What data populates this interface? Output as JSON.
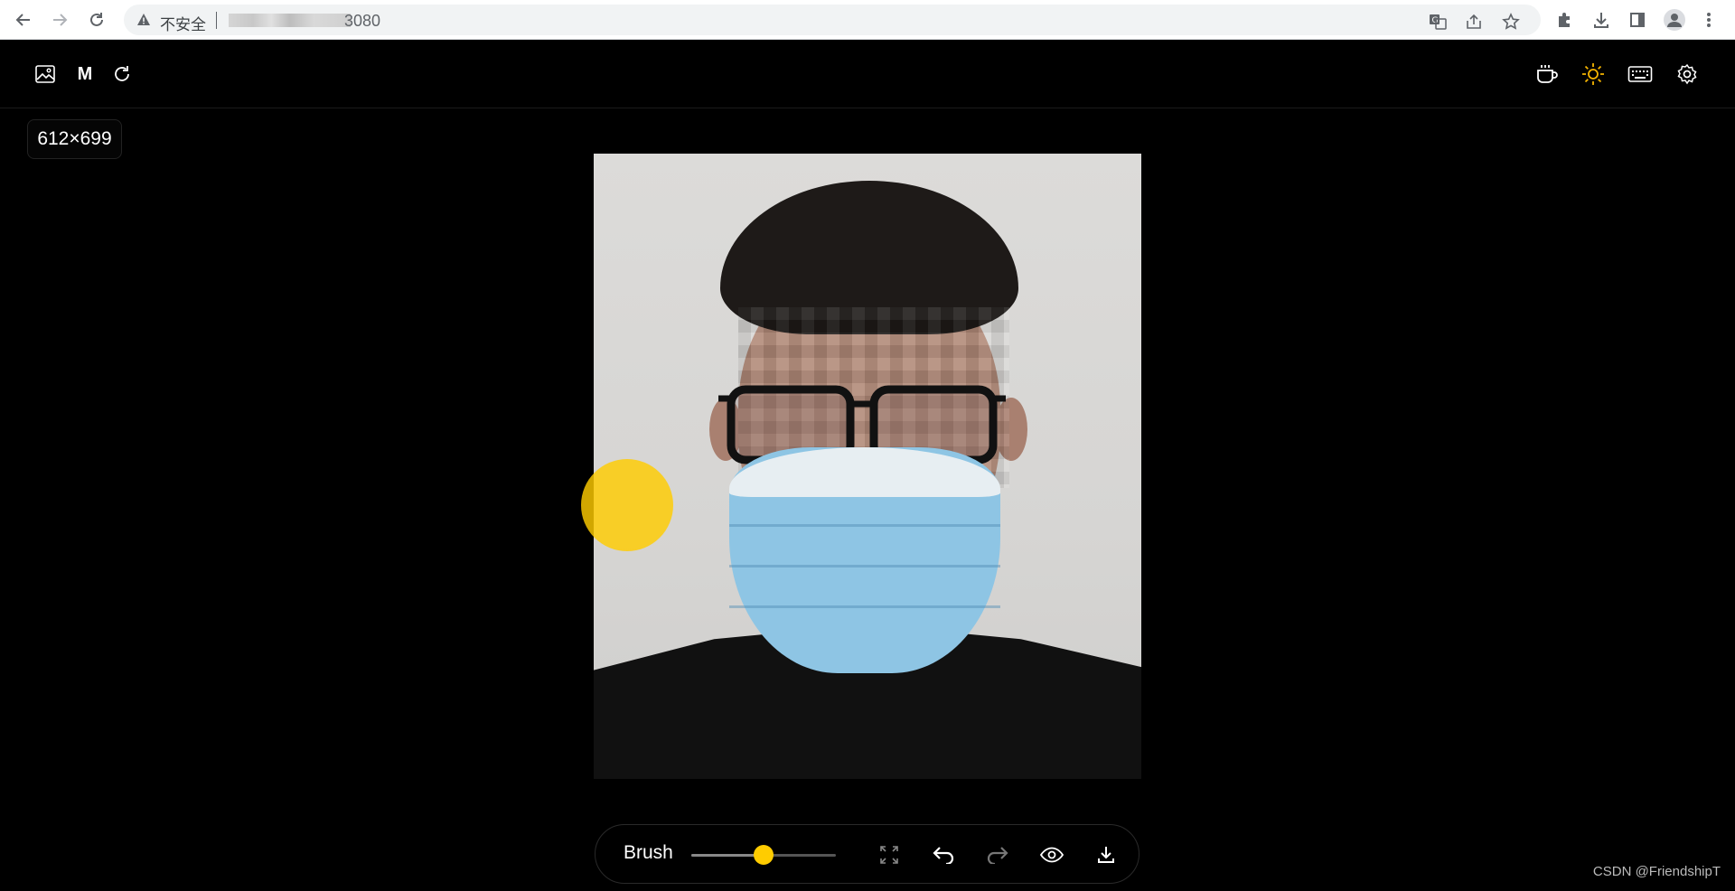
{
  "browser": {
    "security_label": "不安全",
    "url_suffix": "3080",
    "icons": [
      "back-arrow-icon",
      "forward-arrow-icon",
      "reload-icon",
      "warning-icon",
      "translate-icon",
      "share-icon",
      "star-icon",
      "extensions-icon",
      "download-icon",
      "side-panel-icon",
      "profile-icon",
      "kebab-menu-icon"
    ]
  },
  "header": {
    "left_icons": [
      "image-icon",
      "m-mode",
      "redo-rotate-icon"
    ],
    "m_label": "M",
    "right_icons": [
      "coffee-icon",
      "sun-icon",
      "keyboard-icon",
      "gear-icon"
    ],
    "sun_color": "#f5b400"
  },
  "image": {
    "dimensions": "612×699"
  },
  "toolbar": {
    "brush_label": "Brush",
    "brush_size": 0.5,
    "accent_color": "#ffcc00",
    "buttons": [
      "fullscreen-icon",
      "undo-icon",
      "redo-icon",
      "eye-icon",
      "download-icon"
    ]
  },
  "watermark": "CSDN @FriendshipT"
}
